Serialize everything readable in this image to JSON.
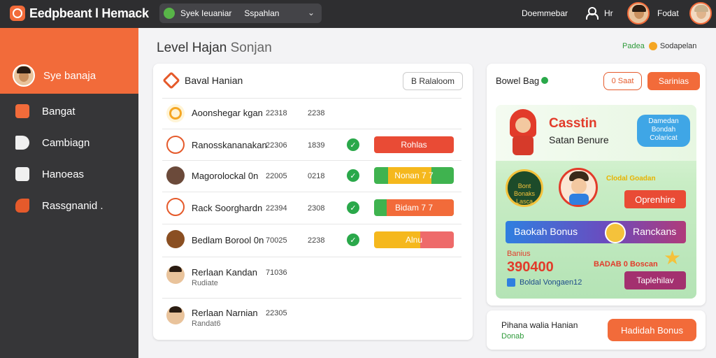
{
  "app": {
    "title": "Eedpbeant l Hemack"
  },
  "topbar": {
    "search_primary": "Syek Ieuaniar",
    "search_secondary": "Sspahlan",
    "right_text": "Doemmebar",
    "user_short": "Hr",
    "account_label": "Fodat"
  },
  "sidebar": {
    "user_name": "Sye banaja",
    "items": [
      {
        "label": "Bangat",
        "icon": "camera-icon"
      },
      {
        "label": "Cambiagn",
        "icon": "megaphone-icon"
      },
      {
        "label": "Hanoeas",
        "icon": "book-icon"
      },
      {
        "label": "Rassgnanid .",
        "icon": "hand-icon"
      }
    ]
  },
  "page": {
    "title_main": "Level Hajan",
    "title_secondary": "Sonjan",
    "status_green": "Padea",
    "status_other": "Sodapelan"
  },
  "leaderboard": {
    "title": "Baval Hanian",
    "action_label": "B Ralaloom",
    "rows": [
      {
        "name": "Aoonshegar kgan",
        "num1": "22318",
        "num2": "2238",
        "badge": "",
        "sub": ""
      },
      {
        "name": "Ranosskananakan",
        "num1": "22306",
        "num2": "1839",
        "badge": "Rohlas",
        "sub": ""
      },
      {
        "name": "Magorolockal 0n",
        "num1": "22005",
        "num2": "0218",
        "badge": "Nonan  7 7",
        "sub": ""
      },
      {
        "name": "Rack Soorghardn",
        "num1": "22394",
        "num2": "2308",
        "badge": "Bidam 7 7",
        "sub": ""
      },
      {
        "name": "Bedlam Borool 0n",
        "num1": "70025",
        "num2": "2238",
        "badge": "Alnu",
        "sub": ""
      },
      {
        "name": "Rerlaan Kandan",
        "num1": "71036",
        "num2": "",
        "badge": "",
        "sub": "Rudiate"
      },
      {
        "name": "Rerlaan Narnian",
        "num1": "22305",
        "num2": "",
        "badge": "",
        "sub": "Randat6"
      }
    ]
  },
  "reward": {
    "title": "Bowel Bag",
    "btn_outline": "0 Saat",
    "btn_fill": "Sarinias",
    "promo": {
      "title": "Casstin",
      "subtitle": "Satan Benure",
      "bubble": "Damedan Bondah Colaricat",
      "badge_text": "Bont Bonaks Lasca",
      "mid_text": "Clodal Goadan",
      "button_a": "Oprenhire",
      "bar_label": "Baokah Bonus",
      "bar_right": "Ranckans",
      "amount_label": "Banius",
      "amount": "390400",
      "amount_right": "BADAB 0 Boscan",
      "button_b": "Taplehilav",
      "footer": "Boldal Vongaen12"
    }
  },
  "bottom_card": {
    "title": "Pihana walia Hanian",
    "subtitle": "Donab",
    "button": "Hadidah Bonus"
  },
  "colors": {
    "accent": "#f26b3a",
    "sidebar": "#363638",
    "topbar": "#2e2e30",
    "success": "#2aa84a",
    "badge_red": "#e94b35",
    "badge_green": "#3fb34f",
    "badge_yellow": "#f5b81d"
  }
}
